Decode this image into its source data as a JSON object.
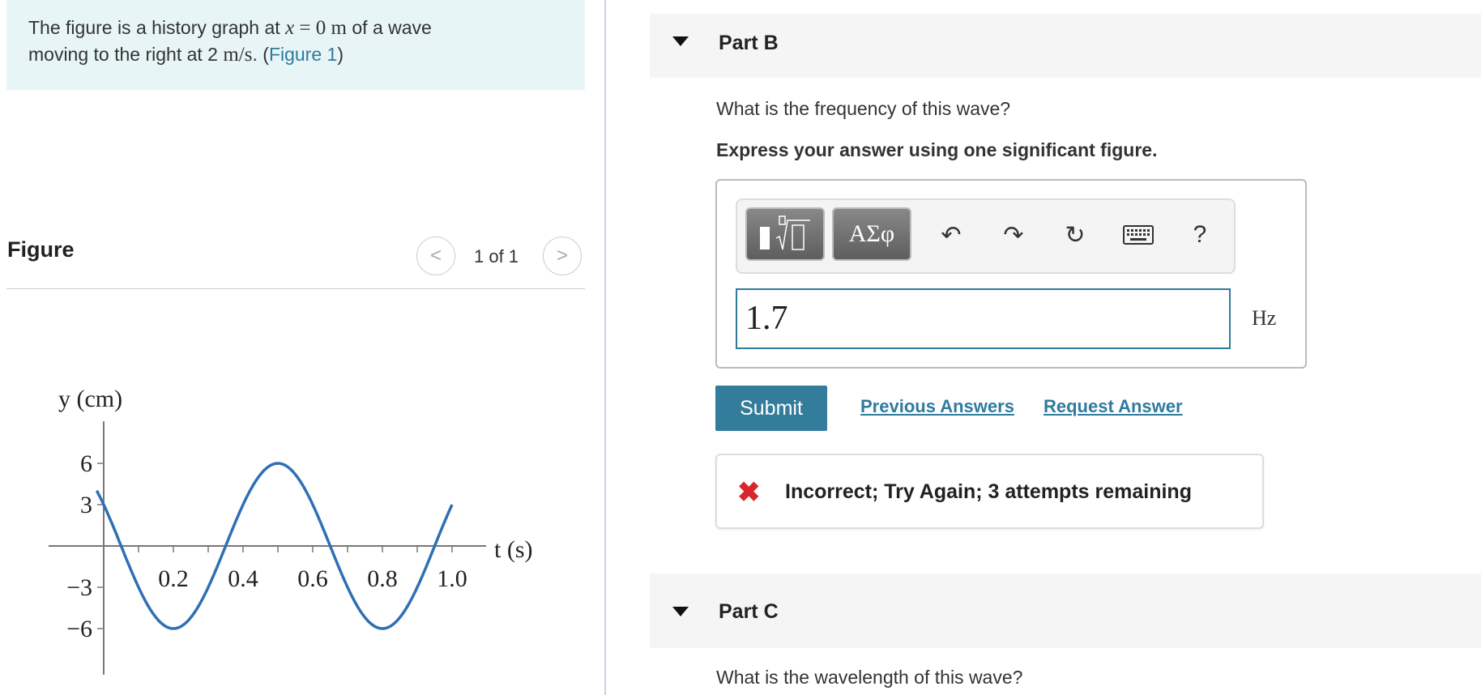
{
  "intro": {
    "text_a": "The figure is a history graph at ",
    "math_x": "x",
    "math_eq": " = ",
    "math_val": "0 m",
    "text_b": " of a wave",
    "text_c": "moving to the right at 2 ",
    "math_unit": "m/s",
    "text_d": ". (",
    "figure_link": "Figure 1",
    "text_e": ")"
  },
  "figure": {
    "title": "Figure",
    "pager": "1 of 1",
    "prev_icon": "chevron-left-icon",
    "next_icon": "chevron-right-icon"
  },
  "chart_data": {
    "type": "line",
    "xlabel": "t (s)",
    "ylabel": "y (cm)",
    "xticks": [
      "0.2",
      "0.4",
      "0.6",
      "0.8",
      "1.0"
    ],
    "yticks": [
      "6",
      "3",
      "−3",
      "−6"
    ],
    "xlim": [
      0,
      1.0
    ],
    "ylim": [
      -6,
      6
    ],
    "series": [
      {
        "color": "#2f6fb3",
        "x": [
          0,
          0.05,
          0.1,
          0.15,
          0.2,
          0.25,
          0.3,
          0.35,
          0.4,
          0.45,
          0.5,
          0.55,
          0.6,
          0.65,
          0.7,
          0.75,
          0.8,
          0.85,
          0.9,
          0.95,
          1.0
        ],
        "y": [
          3,
          0,
          -3,
          -5.2,
          -6,
          -5.2,
          -3,
          0,
          3,
          5.2,
          6,
          5.2,
          3,
          0,
          -3,
          -5.2,
          -6,
          -5.2,
          -3,
          0,
          3
        ]
      }
    ]
  },
  "partB": {
    "label": "Part B",
    "question": "What is the frequency of this wave?",
    "instruction": "Express your answer using one significant figure.",
    "toolbar": {
      "template_icon": "template-sqrt-icon",
      "greek_label": "ΑΣφ",
      "undo_icon": "undo-icon",
      "redo_icon": "redo-icon",
      "reset_icon": "reset-icon",
      "keyboard_icon": "keyboard-icon",
      "help_label": "?"
    },
    "answer_value": "1.7",
    "unit": "Hz",
    "submit_label": "Submit",
    "previous_answers": "Previous Answers",
    "request_answer": "Request Answer",
    "feedback": "Incorrect; Try Again; 3 attempts remaining"
  },
  "partC": {
    "label": "Part C",
    "question": "What is the wavelength of this wave?"
  },
  "colors": {
    "accent": "#337c9c",
    "error": "#d9262c",
    "intro_bg": "#e8f5f6"
  }
}
